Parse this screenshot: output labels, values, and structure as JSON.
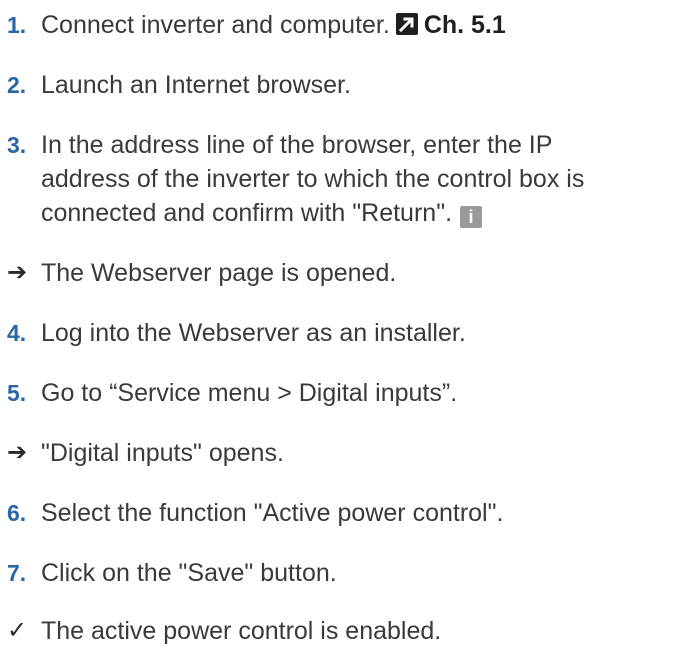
{
  "steps": [
    {
      "marker": "1.",
      "text": "Connect inverter and computer.",
      "ref_icon": "external-reference-icon",
      "ref_text": "Ch. 5.1"
    },
    {
      "marker": "2.",
      "text": "Launch an Internet browser."
    },
    {
      "marker": "3.",
      "lines": [
        "In the address line of the browser, enter the IP",
        "address of the inverter to which the control box is",
        "connected and confirm with \"Return\"."
      ],
      "info_icon": "info-icon",
      "info_glyph": "i"
    },
    {
      "marker": "➔",
      "text": "The Webserver page is opened."
    },
    {
      "marker": "4.",
      "text": "Log into the Webserver as an installer."
    },
    {
      "marker": "5.",
      "text": "Go to “Service menu > Digital inputs”."
    },
    {
      "marker": "➔",
      "text": "\"Digital inputs\" opens."
    },
    {
      "marker": "6.",
      "text": "Select the function \"Active power control\"."
    },
    {
      "marker": "7.",
      "text": "Click on the \"Save\" button."
    },
    {
      "marker": "✓",
      "text": "The active power control is enabled."
    }
  ],
  "colors": {
    "step_number": "#2a66a6",
    "body_text": "#3a3a3a",
    "info_icon_bg": "#9a9a9a",
    "ref_icon_bg": "#1f1f1f"
  }
}
